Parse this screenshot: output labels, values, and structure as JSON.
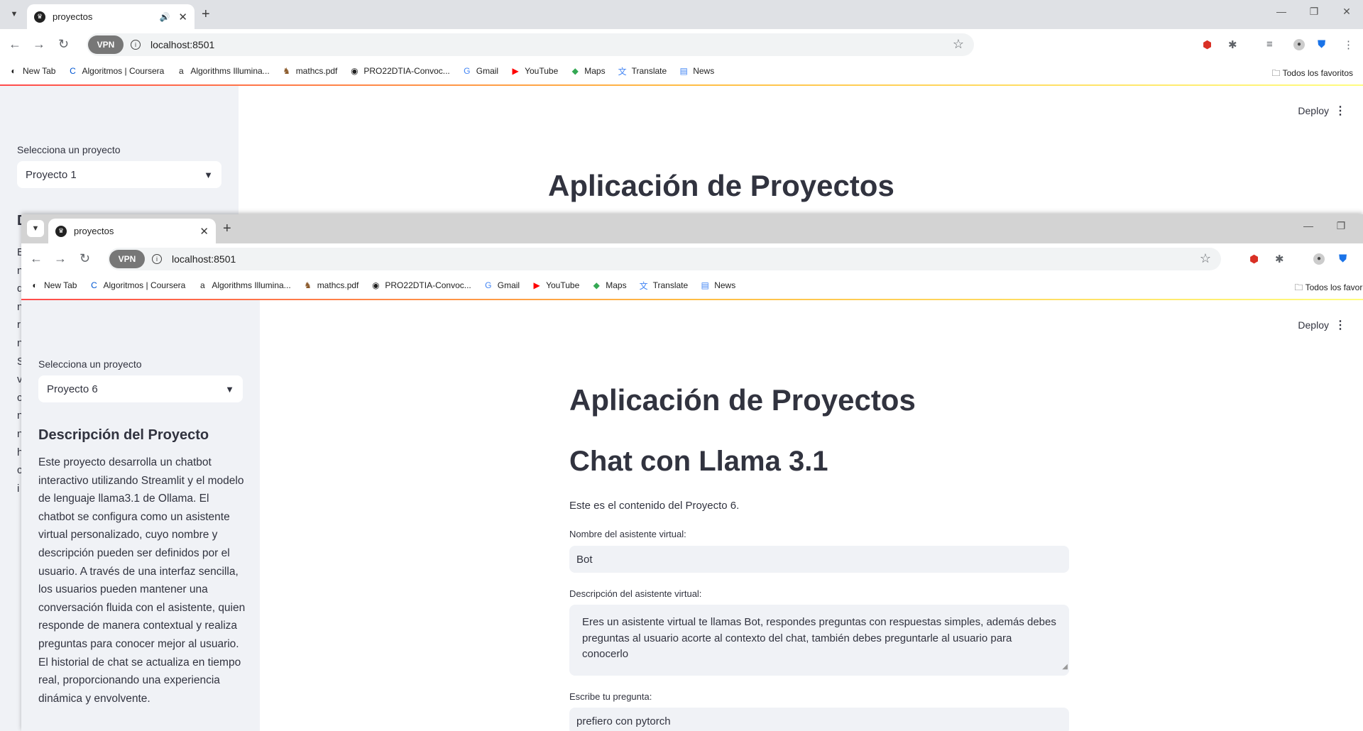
{
  "browser": {
    "tab_title": "proyectos",
    "url": "localhost:8501",
    "vpn_label": "VPN",
    "new_tab_symbol": "+",
    "bookmarks": [
      {
        "label": "New Tab",
        "icon": "newtab-icon"
      },
      {
        "label": "Algoritmos | Coursera",
        "icon": "coursera-icon"
      },
      {
        "label": "Algorithms Illumina...",
        "icon": "amazon-icon"
      },
      {
        "label": "mathcs.pdf",
        "icon": "pdf-icon"
      },
      {
        "label": "PRO22DTIA-Convoc...",
        "icon": "globe-icon"
      },
      {
        "label": "Gmail",
        "icon": "google-icon"
      },
      {
        "label": "YouTube",
        "icon": "youtube-icon"
      },
      {
        "label": "Maps",
        "icon": "maps-icon"
      },
      {
        "label": "Translate",
        "icon": "translate-icon"
      },
      {
        "label": "News",
        "icon": "news-icon"
      }
    ],
    "all_bookmarks": "Todos los favoritos",
    "all_bookmarks_truncated": "Todos los favori"
  },
  "app": {
    "deploy_label": "Deploy",
    "select_label": "Selecciona un proyecto",
    "title": "Aplicación de Proyectos"
  },
  "back_window": {
    "selected_project": "Proyecto 1",
    "sidebar_heading_initial": "D",
    "sidebar_para_initials": [
      "E",
      "n",
      "d",
      "n",
      "r",
      "n",
      "S",
      "v",
      "c",
      "n",
      "n",
      "h",
      "c",
      "i"
    ]
  },
  "front_window": {
    "selected_project": "Proyecto 6",
    "sidebar_heading": "Descripción del Proyecto",
    "sidebar_description": "Este proyecto desarrolla un chatbot interactivo utilizando Streamlit y el modelo de lenguaje llama3.1 de Ollama. El chatbot se configura como un asistente virtual personalizado, cuyo nombre y descripción pueden ser definidos por el usuario. A través de una interfaz sencilla, los usuarios pueden mantener una conversación fluida con el asistente, quien responde de manera contextual y realiza preguntas para conocer mejor al usuario. El historial de chat se actualiza en tiempo real, proporcionando una experiencia dinámica y envolvente.",
    "chat_title": "Chat con Llama 3.1",
    "content_text": "Este es el contenido del Proyecto 6.",
    "name_label": "Nombre del asistente virtual:",
    "name_value": "Bot",
    "desc_label": "Descripción del asistente virtual:",
    "desc_value": "Eres un asistente virtual te llamas Bot, respondes preguntas con respuestas simples, además debes preguntas al usuario acorte al contexto del chat, también debes preguntarle al usuario para conocerlo",
    "question_label": "Escribe tu pregunta:",
    "question_value": "prefiero con pytorch"
  },
  "colors": {
    "accent_red": "#ff4b4b",
    "sidebar_bg": "#f0f2f6",
    "text": "#31333f"
  }
}
